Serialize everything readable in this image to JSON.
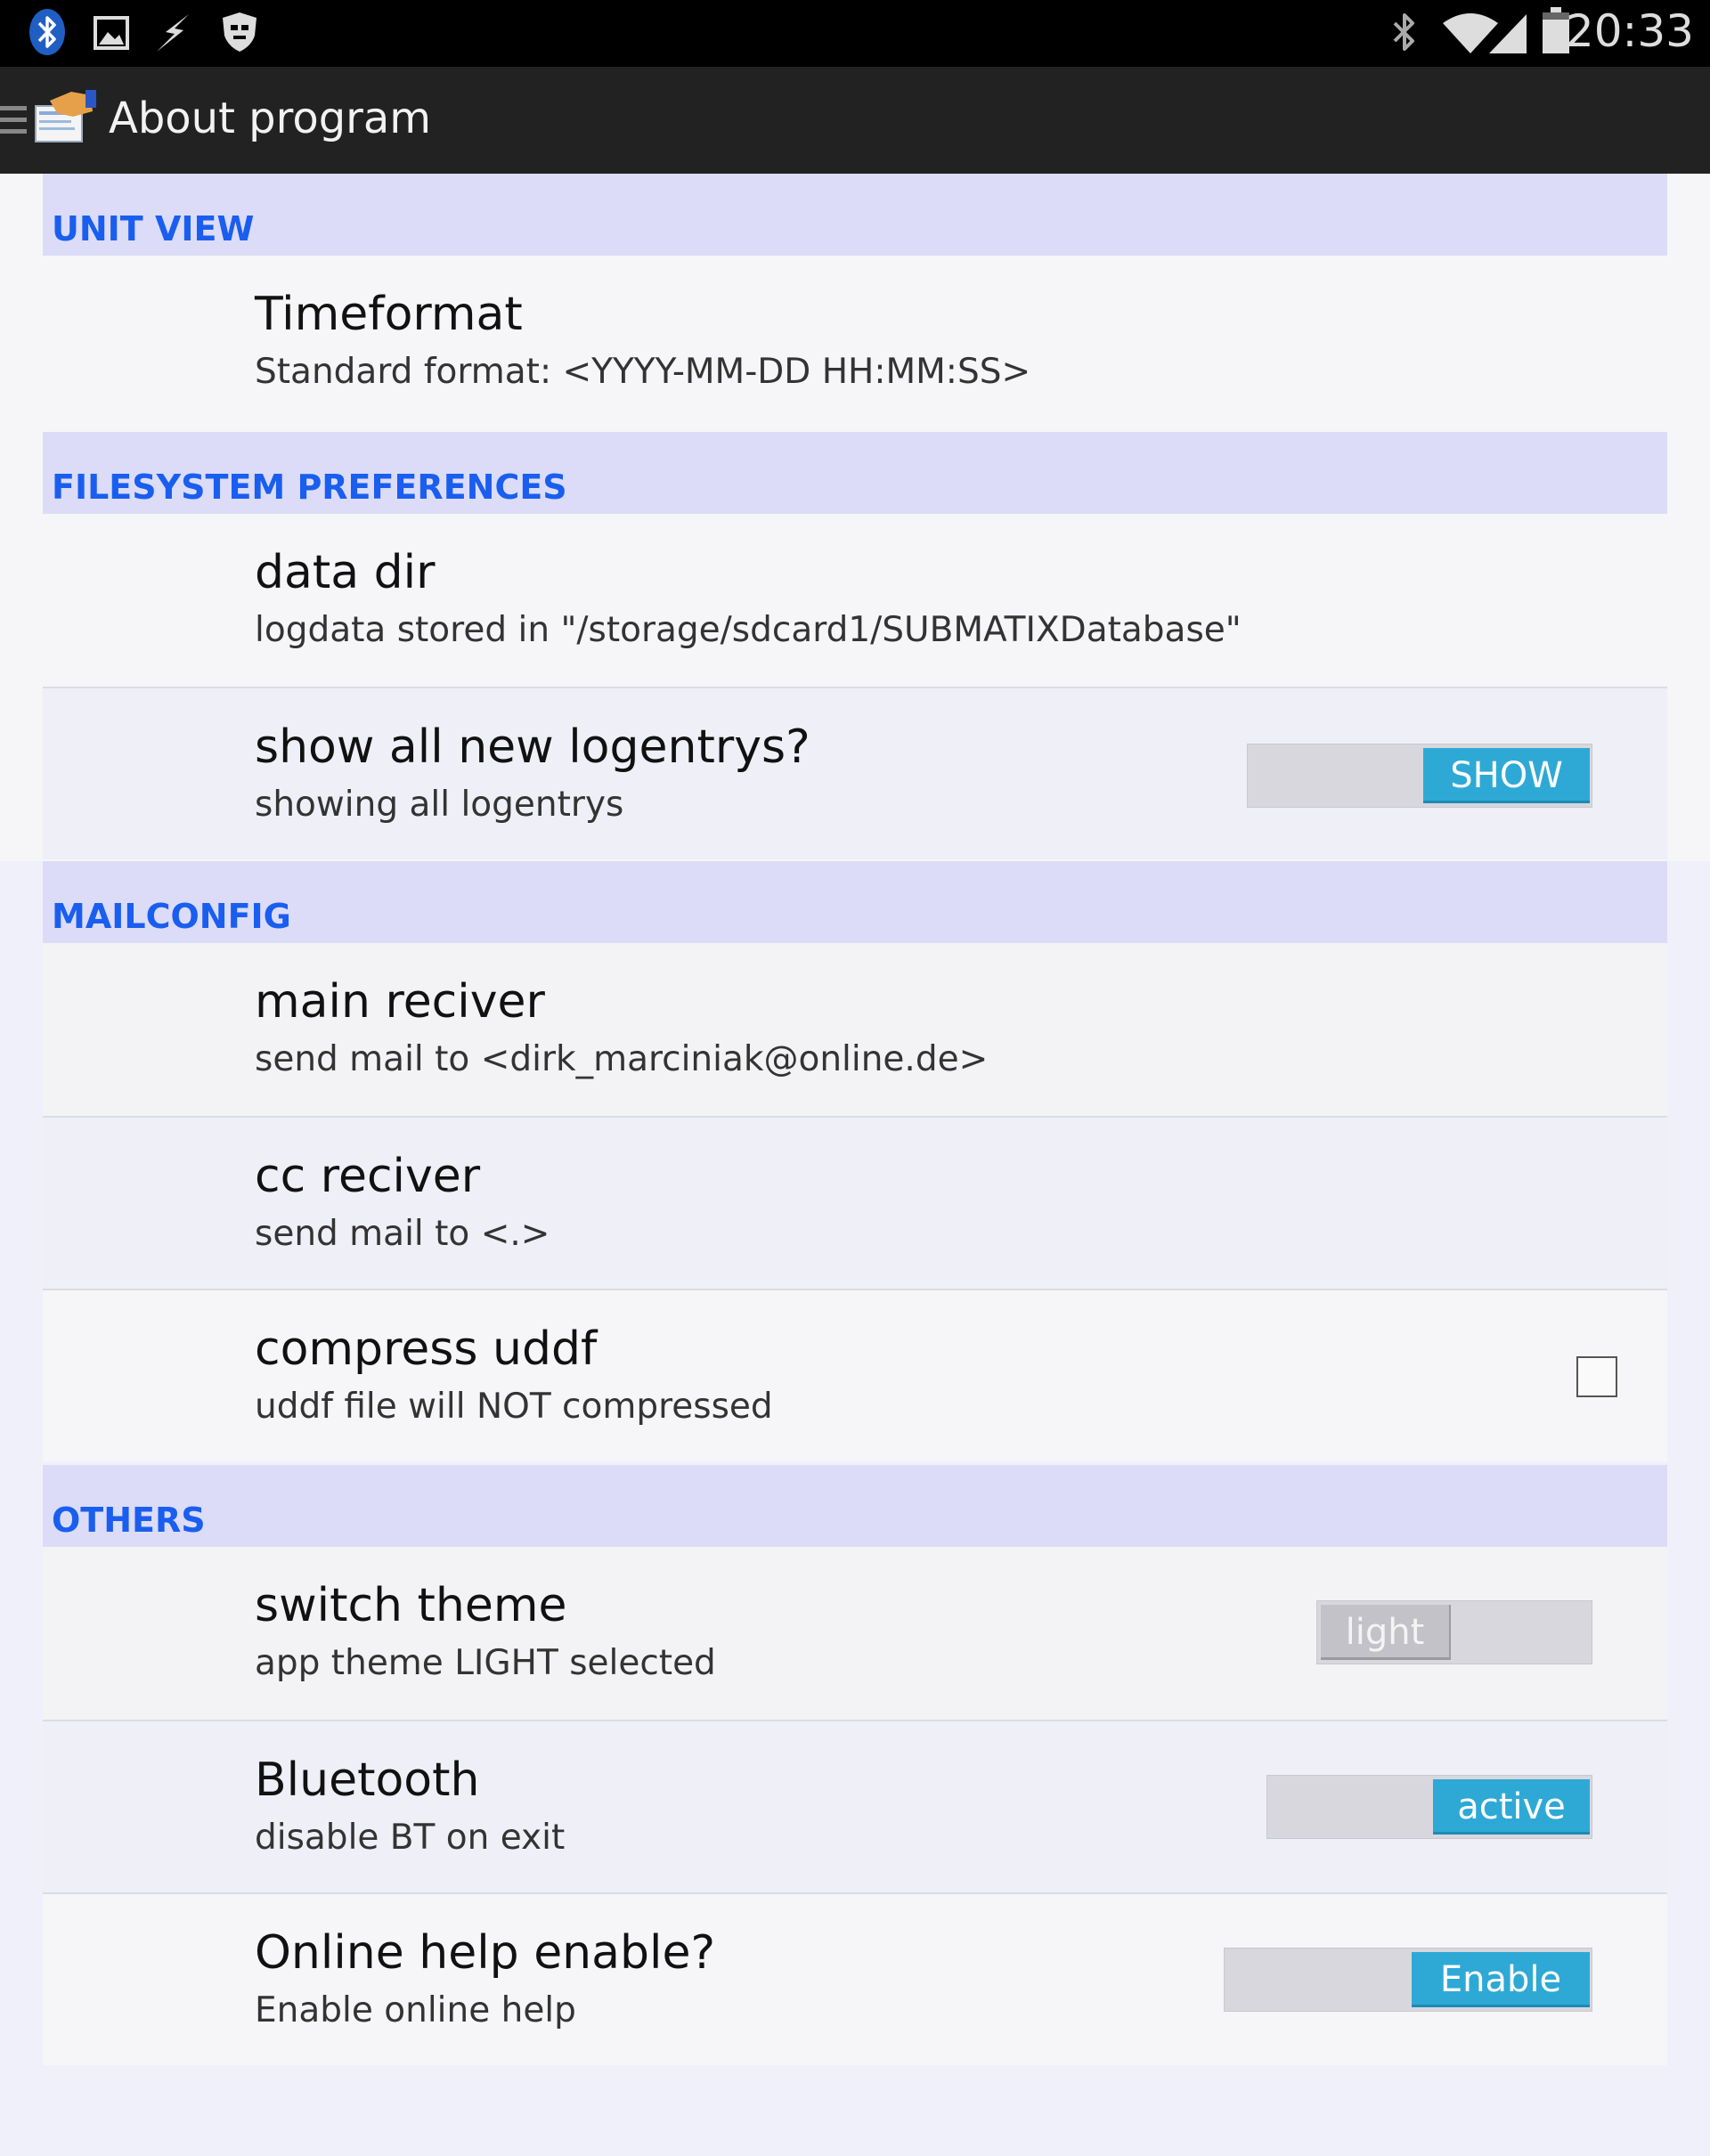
{
  "status_bar": {
    "time": "20:33",
    "left_icons": [
      "bluetooth-icon",
      "image-icon",
      "flash-icon",
      "shield-icon"
    ],
    "right_icons": [
      "bluetooth-icon",
      "wifi-icon",
      "signal-icon",
      "battery-icon"
    ]
  },
  "action_bar": {
    "title": "About program",
    "icons": [
      "menu-icon",
      "app-logo-icon"
    ]
  },
  "sections": {
    "unit_view": {
      "header": "UNIT VIEW",
      "timeformat": {
        "title": "Timeformat",
        "summary": "Standard format: <YYYY-MM-DD HH:MM:SS>"
      }
    },
    "filesystem": {
      "header": "FILESYSTEM PREFERENCES",
      "data_dir": {
        "title": "data dir",
        "summary": "logdata stored in \"/storage/sdcard1/SUBMATIXDatabase\""
      },
      "show_logentrys": {
        "title": "show all new logentrys?",
        "summary": "showing all logentrys",
        "toggle_label": "SHOW",
        "on": true
      }
    },
    "mailconfig": {
      "header": "MAILCONFIG",
      "main_receiver": {
        "title": "main reciver",
        "summary": "send mail to <dirk_marciniak@online.de>"
      },
      "cc_receiver": {
        "title": "cc reciver",
        "summary": "send mail to <.>"
      },
      "compress_uddf": {
        "title": "compress uddf",
        "summary": "uddf file will NOT compressed",
        "checked": false
      }
    },
    "others": {
      "header": "OTHERS",
      "switch_theme": {
        "title": "switch theme",
        "summary": "app theme LIGHT selected",
        "toggle_label": "light",
        "on": false
      },
      "bluetooth": {
        "title": "Bluetooth",
        "summary": "disable BT on exit",
        "toggle_label": "active",
        "on": true
      },
      "online_help": {
        "title": "Online help enable?",
        "summary": "Enable online help",
        "toggle_label": "Enable",
        "on": true
      }
    }
  },
  "colors": {
    "status_bar": "#000000",
    "action_bar": "#222222",
    "header_bg": "#dcdcf8",
    "header_text": "#1a5ef0",
    "toggle_on": "#2ea9d6",
    "toggle_off": "#c2c2c8"
  }
}
